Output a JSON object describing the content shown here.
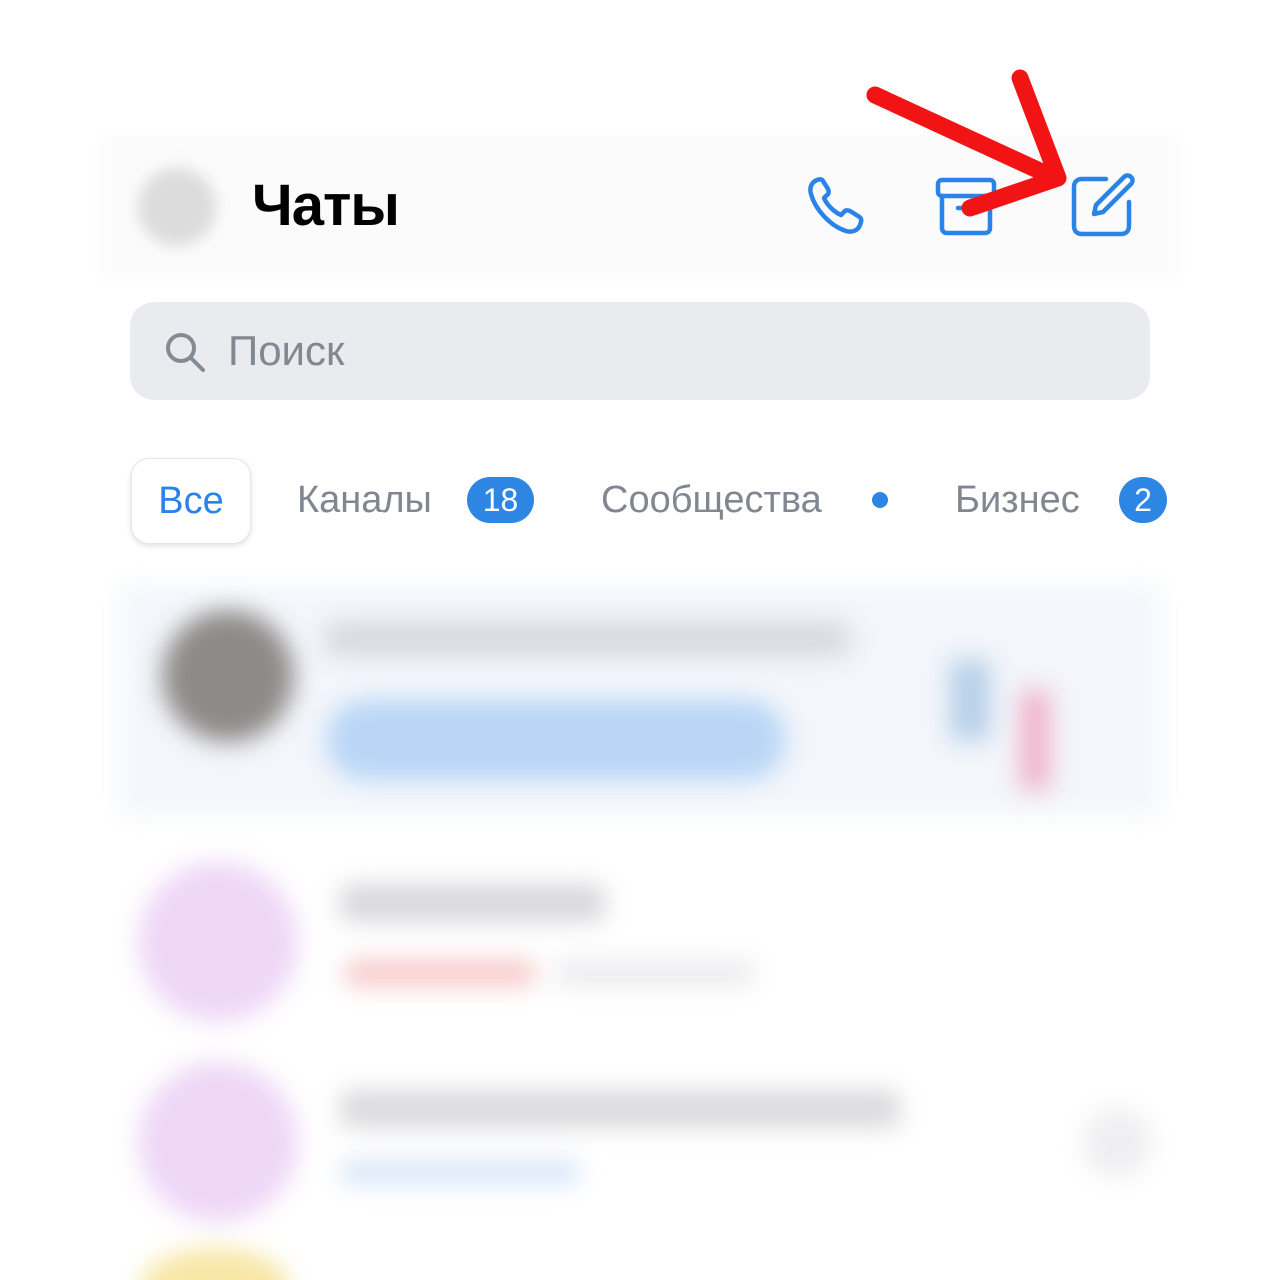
{
  "header": {
    "title": "Чаты",
    "icons": [
      "phone-icon",
      "archive-icon",
      "compose-icon"
    ]
  },
  "search": {
    "placeholder": "Поиск"
  },
  "tabs": [
    {
      "label": "Все",
      "active": true
    },
    {
      "label": "Каналы",
      "badge": "18"
    },
    {
      "label": "Сообщества",
      "indicator": "dot"
    },
    {
      "label": "Бизнес",
      "badge": "2"
    }
  ],
  "colors": {
    "accent": "#2A83E8",
    "badge": "#2E86E4",
    "annotation_arrow": "#F21414",
    "search_bg": "#E9EBEF"
  }
}
